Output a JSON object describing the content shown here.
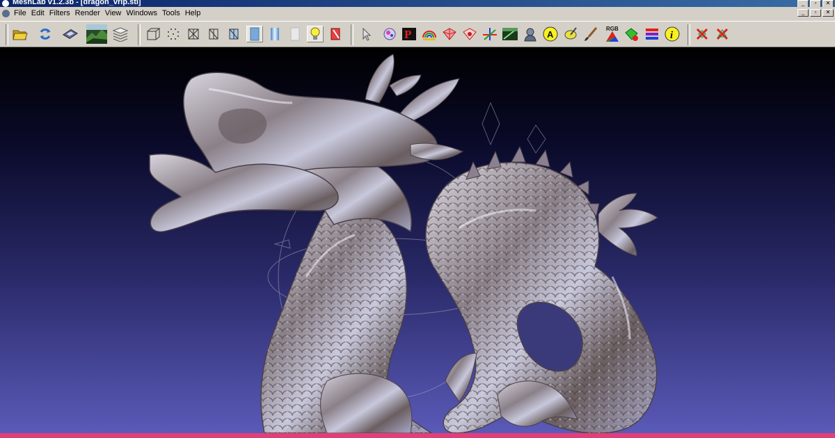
{
  "window": {
    "title": "MeshLab v1.2.3b - [dragon_vrip.stl]"
  },
  "menu": [
    "File",
    "Edit",
    "Filters",
    "Render",
    "View",
    "Windows",
    "Tools",
    "Help"
  ],
  "window_buttons": {
    "minimize": "_",
    "restore": "▫",
    "close": "✕"
  },
  "toolbar_text": {
    "rgb": "RGB",
    "annotation": "A",
    "info": "i"
  },
  "colors": {
    "title_bar": "#0a246a",
    "toolbar_bg": "#d4d0c8",
    "viewport_top": "#000000",
    "viewport_bottom": "#5a5ab8",
    "bottom_bar": "#e0407a",
    "mesh": "#a9a6ad"
  },
  "viewport": {
    "mesh_name": "dragon_vrip.stl"
  }
}
